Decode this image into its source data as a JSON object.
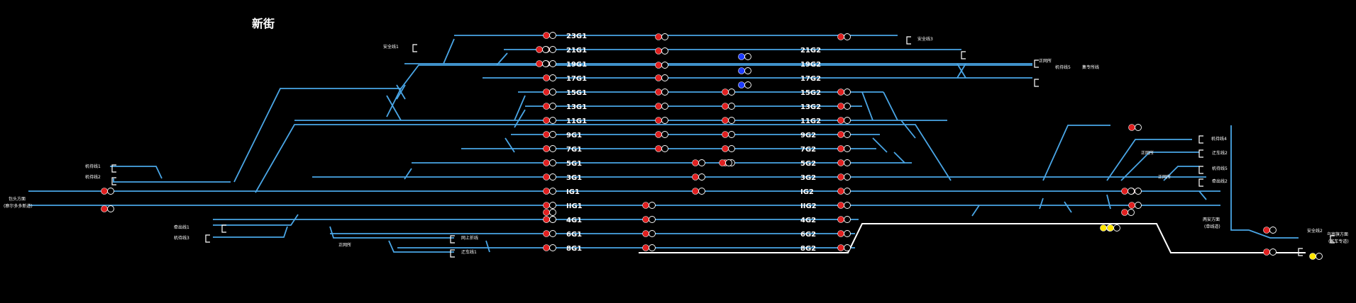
{
  "station": {
    "title": "新街"
  },
  "colors": {
    "background": "#000000",
    "track": "#4aa6e6",
    "route_set": "#ffffff",
    "signal_red": "#e02020",
    "signal_blue": "#1e3cff",
    "signal_yellow": "#ffe600",
    "signal_off": "#000000",
    "text": "#ffffff"
  },
  "tracks": [
    {
      "name": "23G1",
      "side": "west"
    },
    {
      "name": "21G1",
      "side": "west"
    },
    {
      "name": "19G1",
      "side": "west"
    },
    {
      "name": "17G1",
      "side": "west"
    },
    {
      "name": "15G1",
      "side": "west"
    },
    {
      "name": "13G1",
      "side": "west"
    },
    {
      "name": "11G1",
      "side": "west"
    },
    {
      "name": "9G1",
      "side": "west"
    },
    {
      "name": "7G1",
      "side": "west"
    },
    {
      "name": "5G1",
      "side": "west"
    },
    {
      "name": "3G1",
      "side": "west"
    },
    {
      "name": "IG1",
      "side": "west"
    },
    {
      "name": "IIG1",
      "side": "west"
    },
    {
      "name": "4G1",
      "side": "west"
    },
    {
      "name": "6G1",
      "side": "west"
    },
    {
      "name": "8G1",
      "side": "west"
    },
    {
      "name": "21G2",
      "side": "east"
    },
    {
      "name": "19G2",
      "side": "east"
    },
    {
      "name": "17G2",
      "side": "east"
    },
    {
      "name": "15G2",
      "side": "east"
    },
    {
      "name": "13G2",
      "side": "east"
    },
    {
      "name": "11G2",
      "side": "east"
    },
    {
      "name": "9G2",
      "side": "east"
    },
    {
      "name": "7G2",
      "side": "east"
    },
    {
      "name": "5G2",
      "side": "east"
    },
    {
      "name": "3G2",
      "side": "east"
    },
    {
      "name": "IG2",
      "side": "east"
    },
    {
      "name": "IIG2",
      "side": "east"
    },
    {
      "name": "4G2",
      "side": "east"
    },
    {
      "name": "6G2",
      "side": "east"
    },
    {
      "name": "8G2",
      "side": "east"
    }
  ],
  "labels": [
    {
      "text": "安全线1"
    },
    {
      "text": "安全线3"
    },
    {
      "text": "正网所"
    },
    {
      "text": "机待线5"
    },
    {
      "text": "集专所线"
    },
    {
      "text": "机待线1"
    },
    {
      "text": "机待线2"
    },
    {
      "text": "包头方面"
    },
    {
      "text": "(察尔多多新道)"
    },
    {
      "text": "牵出线1"
    },
    {
      "text": "机待线3"
    },
    {
      "text": "网上折线"
    },
    {
      "text": "正网所"
    },
    {
      "text": "迂车线1"
    },
    {
      "text": "机待线4"
    },
    {
      "text": "正网所"
    },
    {
      "text": "迂车线2"
    },
    {
      "text": "机待线5"
    },
    {
      "text": "正网所"
    },
    {
      "text": "牵出线2"
    },
    {
      "text": "两安方面"
    },
    {
      "text": "(单线道)"
    },
    {
      "text": "安全线2"
    },
    {
      "text": "乌审旗方面"
    },
    {
      "text": "(客车专道)"
    }
  ],
  "signals": [
    {
      "state": "red"
    },
    {
      "state": "red"
    },
    {
      "state": "red"
    },
    {
      "state": "red"
    },
    {
      "state": "red"
    },
    {
      "state": "red"
    },
    {
      "state": "red"
    },
    {
      "state": "red"
    },
    {
      "state": "red"
    },
    {
      "state": "red"
    },
    {
      "state": "red"
    },
    {
      "state": "red"
    },
    {
      "state": "red"
    },
    {
      "state": "red"
    },
    {
      "state": "red"
    },
    {
      "state": "red"
    },
    {
      "state": "red"
    },
    {
      "state": "red"
    },
    {
      "state": "red"
    },
    {
      "state": "red"
    },
    {
      "state": "red"
    },
    {
      "state": "red"
    },
    {
      "state": "red"
    },
    {
      "state": "red"
    },
    {
      "state": "red"
    },
    {
      "state": "red"
    },
    {
      "state": "red"
    },
    {
      "state": "red"
    },
    {
      "state": "red"
    },
    {
      "state": "red"
    },
    {
      "state": "red"
    },
    {
      "state": "red"
    },
    {
      "state": "red"
    },
    {
      "state": "red"
    },
    {
      "state": "red"
    },
    {
      "state": "red"
    },
    {
      "state": "red"
    },
    {
      "state": "red"
    },
    {
      "state": "red"
    },
    {
      "state": "red"
    },
    {
      "state": "red"
    },
    {
      "state": "red"
    },
    {
      "state": "red"
    },
    {
      "state": "red"
    },
    {
      "state": "red"
    },
    {
      "state": "red"
    },
    {
      "state": "red"
    },
    {
      "state": "red"
    },
    {
      "state": "red"
    },
    {
      "state": "red"
    },
    {
      "state": "red"
    },
    {
      "state": "red"
    },
    {
      "state": "red"
    },
    {
      "state": "red"
    },
    {
      "state": "red"
    },
    {
      "state": "red"
    },
    {
      "state": "red"
    },
    {
      "state": "red"
    },
    {
      "state": "red"
    },
    {
      "state": "red"
    },
    {
      "state": "blue"
    },
    {
      "state": "blue"
    },
    {
      "state": "blue"
    },
    {
      "state": "red"
    },
    {
      "state": "red"
    },
    {
      "state": "red"
    },
    {
      "state": "red"
    },
    {
      "state": "red"
    },
    {
      "state": "yellow"
    },
    {
      "state": "yellow"
    },
    {
      "state": "yellow"
    }
  ]
}
